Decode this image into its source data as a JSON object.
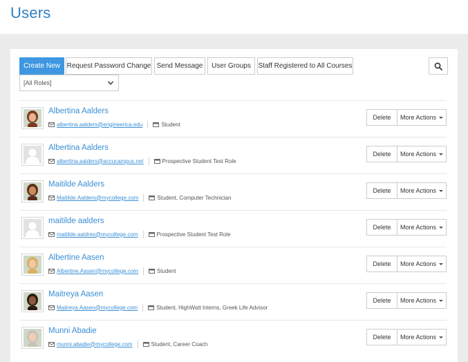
{
  "page": {
    "title": "Users"
  },
  "toolbar": {
    "create_new": "Create New",
    "request_password_change": "Request Password Change",
    "send_message": "Send Message",
    "user_groups": "User Groups",
    "staff_registered": "Staff Registered to All Courses"
  },
  "filter": {
    "role_selected": "[All Roles]"
  },
  "icons": {
    "search": "search-icon",
    "email": "envelope-icon",
    "role": "id-card-icon",
    "dropdown": "chevron-down-icon"
  },
  "colors": {
    "primary": "#3e97e0",
    "link": "#3a8fd6",
    "title": "#2f7fc3"
  },
  "row_actions": {
    "delete": "Delete",
    "more": "More Actions"
  },
  "users": [
    {
      "name": "Albertina Aalders",
      "email": "albertina.aalders@engineerica.edu",
      "roles": "Student",
      "photo": true
    },
    {
      "name": "Albertina Aalders",
      "email": "albertina.aalders@accucampus.net",
      "roles": "Prospective Student Test Role",
      "photo": false
    },
    {
      "name": "Maitilde Aalders",
      "email": "Maitilde.Aalders@mycollege.com",
      "roles": "Student, Computer Technician",
      "photo": true
    },
    {
      "name": "maitilde aalders",
      "email": "maitilde.aaldres@mycollege.com",
      "roles": "Prospective Student Test Role",
      "photo": false
    },
    {
      "name": "Albertine Aasen",
      "email": "Albertine.Aasen@mycollege.com",
      "roles": "Student",
      "photo": true
    },
    {
      "name": "Maitreya Aasen",
      "email": "Maitreya.Aasen@mycollege.com",
      "roles": "Student, HighWatt Interns, Greek Life Advisor",
      "photo": true
    },
    {
      "name": "Munni Abadie",
      "email": "munni.abadie@mycollege.com",
      "roles": "Student, Career Coach",
      "photo": true
    }
  ]
}
